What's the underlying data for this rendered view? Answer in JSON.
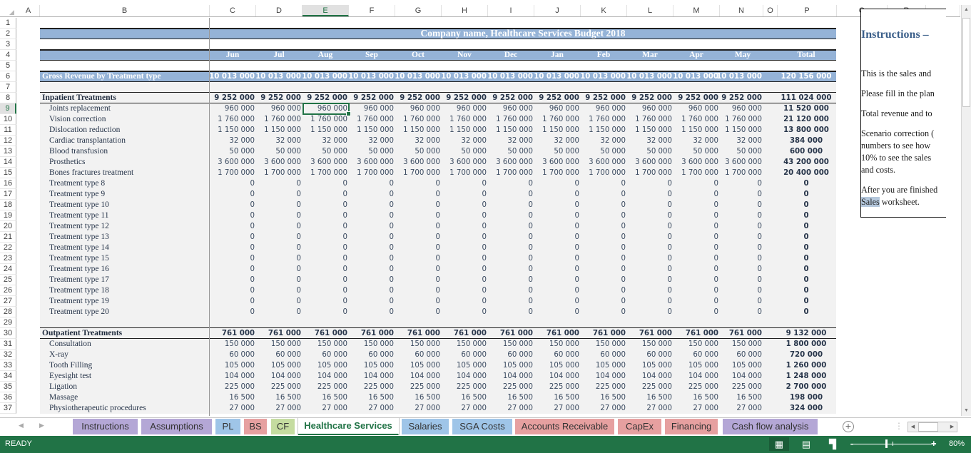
{
  "app": {
    "status": "READY",
    "zoom_level": "80%"
  },
  "columns": [
    "A",
    "B",
    "C",
    "D",
    "E",
    "F",
    "G",
    "H",
    "I",
    "J",
    "K",
    "L",
    "M",
    "N",
    "O",
    "P",
    "Q",
    "R"
  ],
  "selected_column": "E",
  "selected_row": 9,
  "selected_cell": "E9",
  "rows": [
    "1",
    "2",
    "3",
    "4",
    "5",
    "6",
    "7",
    "8",
    "9",
    "10",
    "11",
    "12",
    "13",
    "14",
    "15",
    "16",
    "17",
    "18",
    "19",
    "20",
    "21",
    "22",
    "23",
    "24",
    "25",
    "26",
    "27",
    "28",
    "29",
    "30",
    "31",
    "32",
    "33",
    "34",
    "35",
    "36",
    "37"
  ],
  "sheet": {
    "title": "Company name, Healthcare Services Budget 2018",
    "months": [
      "Jun",
      "Jul",
      "Aug",
      "Sep",
      "Oct",
      "Nov",
      "Dec",
      "Jan",
      "Feb",
      "Mar",
      "Apr",
      "May"
    ],
    "total_label": "Total",
    "gross": {
      "label": "Gross Revenue by Treatment type",
      "monthly": "10 013 000",
      "total": "120 156 000"
    },
    "inpatient": {
      "label": "Inpatient Treatments",
      "monthly": "9 252 000",
      "total": "111 024 000",
      "items": [
        {
          "label": "Joints replacement",
          "monthly": "960 000",
          "total": "11 520 000"
        },
        {
          "label": "Vision correction",
          "monthly": "1 760 000",
          "total": "21 120 000"
        },
        {
          "label": "Dislocation reduction",
          "monthly": "1 150 000",
          "total": "13 800 000"
        },
        {
          "label": "Cardiac transplantation",
          "monthly": "32 000",
          "total": "384 000"
        },
        {
          "label": "Blood transfusion",
          "monthly": "50 000",
          "total": "600 000"
        },
        {
          "label": "Prosthetics",
          "monthly": "3 600 000",
          "total": "43 200 000"
        },
        {
          "label": "Bones fractures treatment",
          "monthly": "1 700 000",
          "total": "20 400 000"
        },
        {
          "label": "Treatment type 8",
          "monthly": "0",
          "total": "0"
        },
        {
          "label": "Treatment type 9",
          "monthly": "0",
          "total": "0"
        },
        {
          "label": "Treatment type 10",
          "monthly": "0",
          "total": "0"
        },
        {
          "label": "Treatment type 11",
          "monthly": "0",
          "total": "0"
        },
        {
          "label": "Treatment type 12",
          "monthly": "0",
          "total": "0"
        },
        {
          "label": "Treatment type 13",
          "monthly": "0",
          "total": "0"
        },
        {
          "label": "Treatment type 14",
          "monthly": "0",
          "total": "0"
        },
        {
          "label": "Treatment type 15",
          "monthly": "0",
          "total": "0"
        },
        {
          "label": "Treatment type 16",
          "monthly": "0",
          "total": "0"
        },
        {
          "label": "Treatment type 17",
          "monthly": "0",
          "total": "0"
        },
        {
          "label": "Treatment type 18",
          "monthly": "0",
          "total": "0"
        },
        {
          "label": "Treatment type 19",
          "monthly": "0",
          "total": "0"
        },
        {
          "label": "Treatment type 20",
          "monthly": "0",
          "total": "0"
        }
      ]
    },
    "outpatient": {
      "label": "Outpatient Treatments",
      "monthly": "761 000",
      "total": "9 132 000",
      "items": [
        {
          "label": "Consultation",
          "monthly": "150 000",
          "total": "1 800 000"
        },
        {
          "label": "X-ray",
          "monthly": "60 000",
          "total": "720 000"
        },
        {
          "label": "Tooth Filling",
          "monthly": "105 000",
          "total": "1 260 000"
        },
        {
          "label": "Eyesight test",
          "monthly": "104 000",
          "total": "1 248 000"
        },
        {
          "label": "Ligation",
          "monthly": "225 000",
          "total": "2 700 000"
        },
        {
          "label": "Massage",
          "monthly": "16 500",
          "total": "198 000"
        },
        {
          "label": "Physiotherapeutic procedures",
          "monthly": "27 000",
          "total": "324 000"
        }
      ]
    }
  },
  "instructions": {
    "title": "Instructions – ",
    "lines": [
      "This is the sales and",
      "Please fill in the plan",
      "Total revenue and to",
      "Scenario correction (",
      "numbers to see how",
      "10% to see the sales",
      "and costs.",
      "After you are finished",
      "worksheet."
    ],
    "highlighted_word": "Sales"
  },
  "tabs": [
    {
      "label": "Instructions",
      "color": "#b4a7d6"
    },
    {
      "label": "Assumptions",
      "color": "#b4a7d6"
    },
    {
      "label": "PL",
      "color": "#9fc5e8"
    },
    {
      "label": "BS",
      "color": "#e6a0a0"
    },
    {
      "label": "CF",
      "color": "#c5dca0"
    },
    {
      "label": "Healthcare Services",
      "color": "#ffffff",
      "active": true
    },
    {
      "label": "Salaries",
      "color": "#9fc5e8"
    },
    {
      "label": "SGA Costs",
      "color": "#9fc5e8"
    },
    {
      "label": "Accounts Receivable",
      "color": "#e6a0a0"
    },
    {
      "label": "CapEx",
      "color": "#e6a0a0"
    },
    {
      "label": "Financing",
      "color": "#e6a0a0"
    },
    {
      "label": "Cash flow analysis",
      "color": "#b4a7d6"
    }
  ],
  "icons": {
    "add_sheet": "+",
    "nav_prev": "◀",
    "nav_next": "▶",
    "scroll_up": "▲",
    "scroll_down": "▼",
    "view_normal": "▦",
    "view_page_layout": "▤",
    "view_page_break": "▜",
    "zoom_out": "-",
    "zoom_in": "+"
  }
}
